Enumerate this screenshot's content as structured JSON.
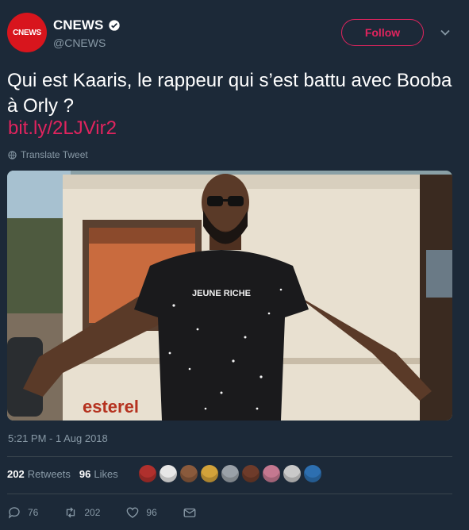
{
  "account": {
    "avatar_text": "CNEWS",
    "display_name": "CNEWS",
    "handle": "@CNEWS",
    "verified": true
  },
  "follow_label": "Follow",
  "tweet": {
    "text": "Qui est Kaaris, le rappeur qui s’est battu avec Booba à Orly ?",
    "link": "bit.ly/2LJVir2",
    "translate_label": "Translate Tweet",
    "photo_caption": "esterel",
    "shirt_text": "JEUNE RICHE",
    "timestamp": "5:21 PM - 1 Aug 2018"
  },
  "stats": {
    "retweets_count": "202",
    "retweets_label": "Retweets",
    "likes_count": "96",
    "likes_label": "Likes"
  },
  "liker_avatars": [
    {
      "color": "#b0302d"
    },
    {
      "color": "#e7e7e7"
    },
    {
      "color": "#8a5a3c"
    },
    {
      "color": "#d2a23a"
    },
    {
      "color": "#9aa1a8"
    },
    {
      "color": "#6e3b2a"
    },
    {
      "color": "#c47890"
    },
    {
      "color": "#c9c9c9"
    },
    {
      "color": "#2d6fb0"
    }
  ],
  "actions": {
    "reply_count": "76",
    "retweet_count": "202",
    "like_count": "96"
  },
  "colors": {
    "background": "#1c2938",
    "accent": "#e0245e",
    "muted": "#8899a6",
    "divider": "#38444d"
  }
}
